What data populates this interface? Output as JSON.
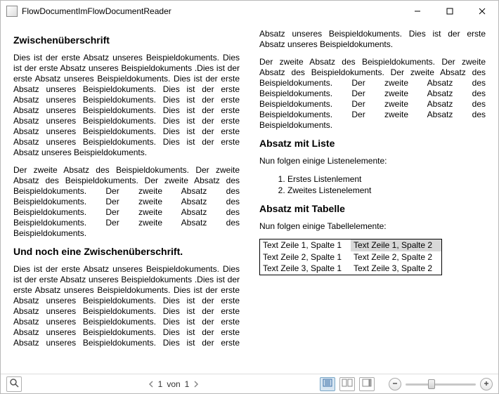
{
  "window": {
    "title": "FlowDocumentImFlowDocumentReader"
  },
  "doc": {
    "h1": "Zwischenüberschrift",
    "p1": "Dies ist der erste Absatz unseres Beispieldokuments. Dies ist der erste Absatz unseres Beispieldokuments .Dies ist der erste Absatz unseres Beispieldokuments. Dies ist der erste Absatz unseres Beispieldokuments. Dies ist der erste Absatz unseres Beispieldokuments. Dies ist der erste Absatz unseres Beispieldokuments. Dies ist der erste Absatz unseres Beispieldokuments. Dies ist der erste Absatz unseres Beispieldokuments. Dies ist der erste Absatz unseres Beispieldokuments. Dies ist der erste Absatz unseres Beispieldokuments.",
    "p2": "Der zweite Absatz des Beispieldokuments. Der zweite Absatz des Beispieldokuments. Der zweite Absatz des Beispieldokuments. Der zweite Absatz des Beispieldokuments. Der zweite Absatz des Beispieldokuments. Der zweite Absatz des Beispieldokuments. Der zweite Absatz des Beispieldokuments.",
    "h2": "Und noch eine Zwischenüberschrift.",
    "p3": "Dies ist der erste Absatz unseres Beispieldokuments. Dies ist der erste Absatz unseres Beispieldokuments .Dies ist der erste Absatz unseres Beispieldokuments. Dies ist der erste Absatz unseres Beispieldokuments. Dies ist der erste Absatz unseres Beispieldokuments. Dies ist der erste Absatz unseres Beispieldokuments. Dies ist der erste Absatz unseres Beispieldokuments. Dies ist der erste Absatz unseres Beispieldokuments. Dies ist der erste Absatz unseres Beispieldokuments. Dies ist der erste Absatz unseres Beispieldokuments.",
    "p4": "Der zweite Absatz des Beispieldokuments. Der zweite Absatz des Beispieldokuments. Der zweite Absatz des Beispieldokuments. Der zweite Absatz des Beispieldokuments. Der zweite Absatz des Beispieldokuments. Der zweite Absatz des Beispieldokuments. Der zweite Absatz des Beispieldokuments.",
    "h3": "Absatz mit Liste",
    "p5": "Nun folgen einige Listenelemente:",
    "list": [
      "Erstes Listenlement",
      "Zweites Listenelement"
    ],
    "h4": "Absatz mit Tabelle",
    "p6": "Nun folgen einige Tabellelemente:",
    "table": [
      [
        "Text Zeile 1, Spalte 1",
        "Text Zeile 1, Spalte 2"
      ],
      [
        "Text Zeile 2, Spalte 1",
        "Text Zeile 2, Spalte 2"
      ],
      [
        "Text Zeile 3, Spalte 1",
        "Text Zeile 3, Spalte 2"
      ]
    ]
  },
  "toolbar": {
    "pager_current": "1",
    "pager_sep": "von",
    "pager_total": "1"
  }
}
